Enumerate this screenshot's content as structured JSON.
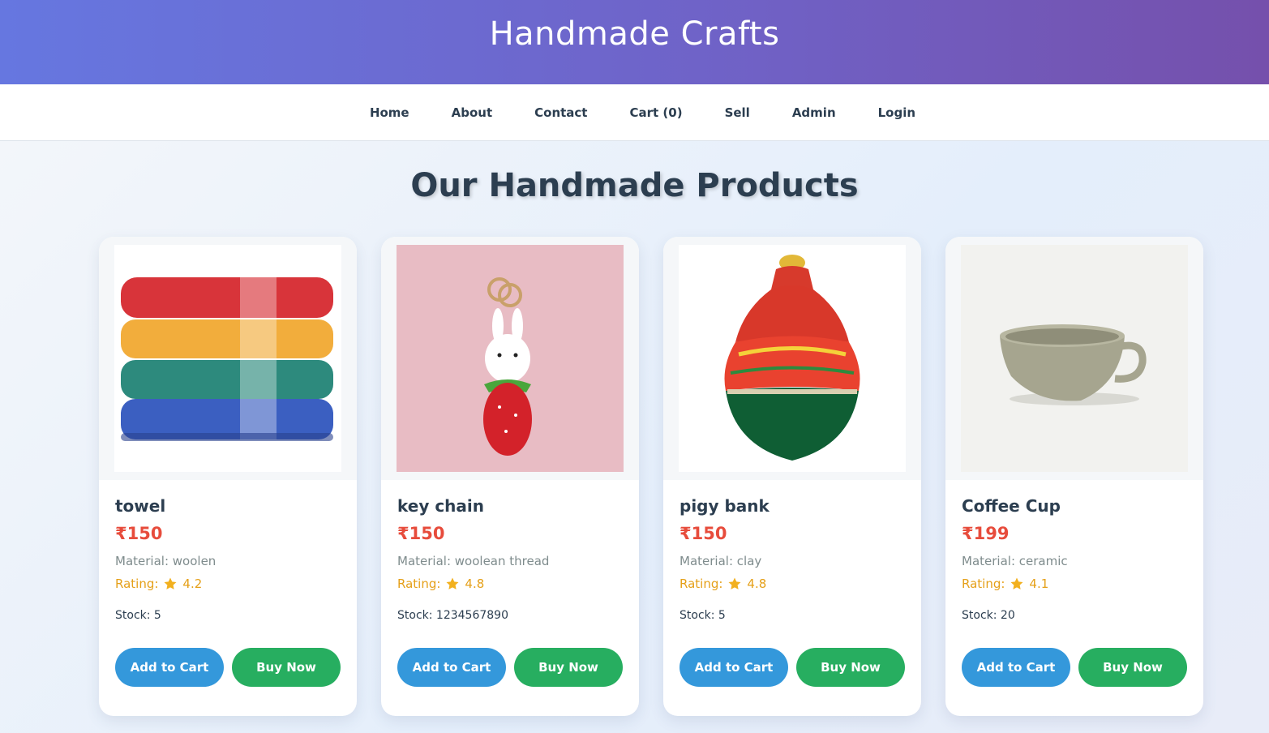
{
  "header": {
    "title": "Handmade Crafts"
  },
  "nav": [
    {
      "label": "Home"
    },
    {
      "label": "About"
    },
    {
      "label": "Contact"
    },
    {
      "label": "Cart (0)"
    },
    {
      "label": "Sell"
    },
    {
      "label": "Admin"
    },
    {
      "label": "Login"
    }
  ],
  "page": {
    "heading": "Our Handmade Products"
  },
  "products": [
    {
      "name": "towel",
      "price": "₹150",
      "material_label": "Material:",
      "material": "woolen",
      "rating_label": "Rating:",
      "rating": "4.2",
      "stock_label": "Stock:",
      "stock": "5",
      "add_label": "Add to Cart",
      "buy_label": "Buy Now"
    },
    {
      "name": "key chain",
      "price": "₹150",
      "material_label": "Material:",
      "material": "woolean thread",
      "rating_label": "Rating:",
      "rating": "4.8",
      "stock_label": "Stock:",
      "stock": "1234567890",
      "add_label": "Add to Cart",
      "buy_label": "Buy Now"
    },
    {
      "name": "pigy bank",
      "price": "₹150",
      "material_label": "Material:",
      "material": "clay",
      "rating_label": "Rating:",
      "rating": "4.8",
      "stock_label": "Stock:",
      "stock": "5",
      "add_label": "Add to Cart",
      "buy_label": "Buy Now"
    },
    {
      "name": "Coffee Cup",
      "price": "₹199",
      "material_label": "Material:",
      "material": "ceramic",
      "rating_label": "Rating:",
      "rating": "4.1",
      "stock_label": "Stock:",
      "stock": "20",
      "add_label": "Add to Cart",
      "buy_label": "Buy Now"
    }
  ],
  "colors": {
    "price": "#e74c3c",
    "rating": "#e5a019",
    "add_button": "#3498db",
    "buy_button": "#27ae60",
    "header_gradient_start": "#6677e0",
    "header_gradient_end": "#7550ac"
  },
  "icons": {
    "rating": "star-icon"
  }
}
